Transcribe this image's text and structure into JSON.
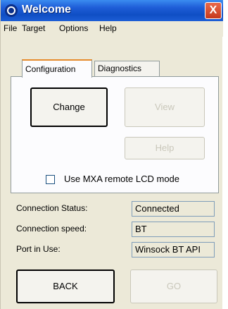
{
  "window": {
    "title": "Welcome",
    "close_label": "X"
  },
  "menu": {
    "items": [
      "File",
      "Target",
      "Options",
      "Help"
    ]
  },
  "tabs": [
    {
      "label": "Configuration",
      "active": true
    },
    {
      "label": "Diagnostics",
      "active": false
    }
  ],
  "config": {
    "change_label": "Change",
    "view_label": "View",
    "help_label": "Help",
    "lcd_checkbox_label": "Use MXA remote LCD mode",
    "lcd_checkbox_checked": false
  },
  "connection": {
    "status_label": "Connection Status:",
    "status_value": "Connected",
    "speed_label": "Connection speed:",
    "speed_value": "BT",
    "port_label": "Port in Use:",
    "port_value": "Winsock BT API"
  },
  "footer": {
    "back_label": "BACK",
    "go_label": "GO"
  },
  "icons": {
    "app": "app-logo-icon",
    "close": "close-icon"
  },
  "colors": {
    "titlebar": "#1f5ed8",
    "window_bg": "#ece9d8",
    "close": "#c6391c"
  }
}
